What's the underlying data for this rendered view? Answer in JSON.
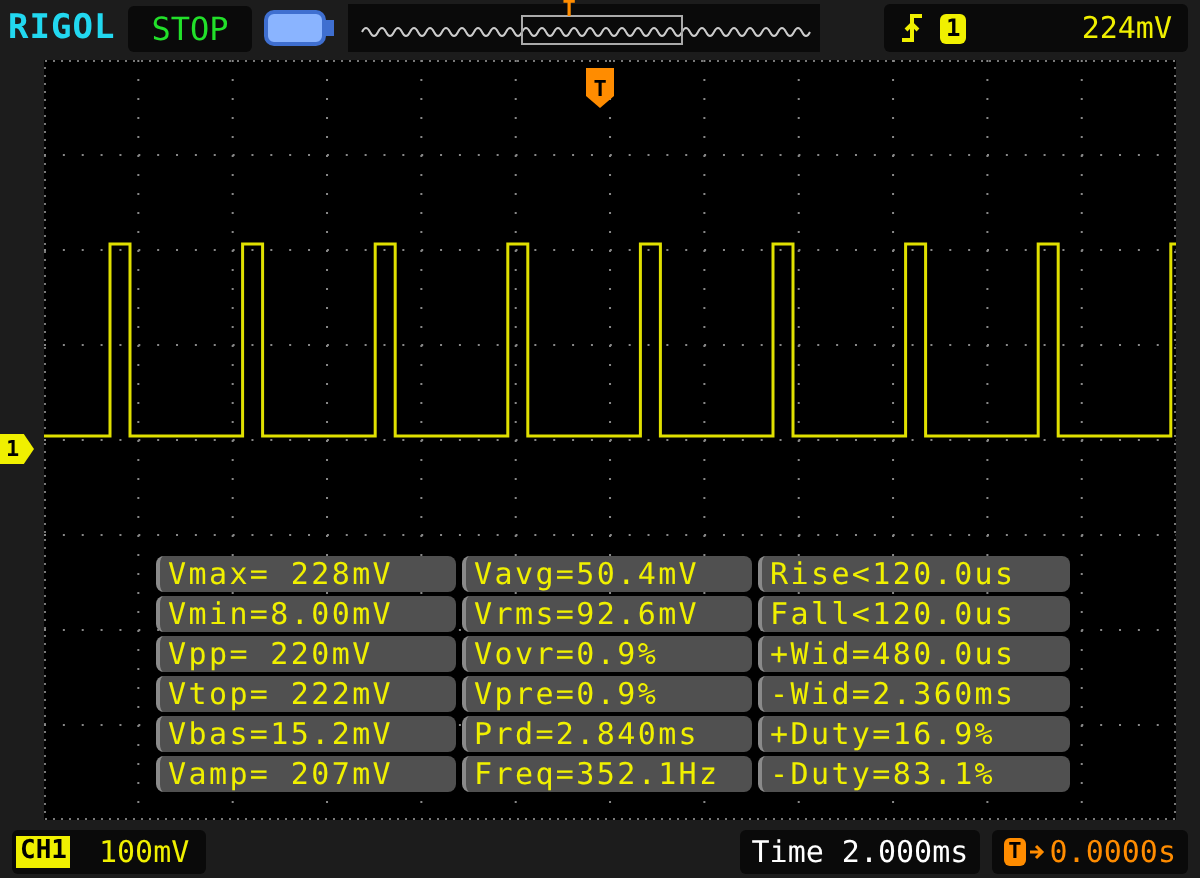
{
  "brand": "RIGOL",
  "run_state": "STOP",
  "memory_bar": {
    "trigger_marker": "T"
  },
  "trigger": {
    "channel": "1",
    "level": "224mV"
  },
  "plot": {
    "trigger_marker": "T",
    "channel_marker": "1"
  },
  "measurements": [
    [
      "Vmax= 228mV",
      "Vavg=50.4mV",
      "Rise<120.0us"
    ],
    [
      "Vmin=8.00mV",
      "Vrms=92.6mV",
      "Fall<120.0us"
    ],
    [
      "Vpp= 220mV",
      "Vovr=0.9%",
      "+Wid=480.0us"
    ],
    [
      "Vtop= 222mV",
      "Vpre=0.9%",
      "-Wid=2.360ms"
    ],
    [
      "Vbas=15.2mV",
      "Prd=2.840ms",
      "+Duty=16.9%"
    ],
    [
      "Vamp= 207mV",
      "Freq=352.1Hz",
      "-Duty=83.1%"
    ]
  ],
  "status_bar": {
    "channel": "CH1",
    "scale": "100mV",
    "time": "Time 2.000ms",
    "trigger_icon": "T",
    "trigger_offset": "0.0000s"
  }
}
